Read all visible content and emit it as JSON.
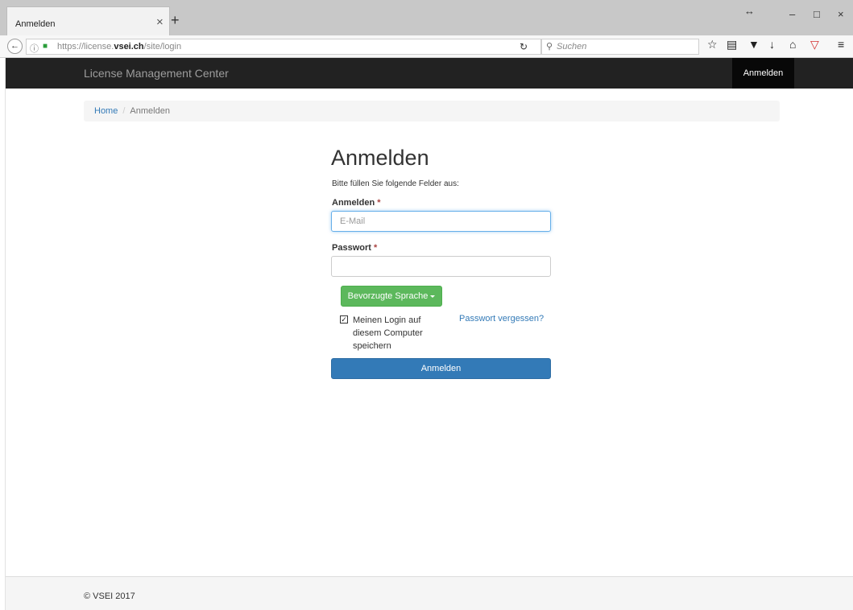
{
  "browser": {
    "tab_title": "Anmelden",
    "tab_close": "×",
    "new_tab": "+",
    "url_prefix": "https://license.",
    "url_domain": "vsei.ch",
    "url_path": "/site/login",
    "search_placeholder": "Suchen",
    "window": {
      "restore": "↔",
      "minimize": "–",
      "maximize": "□",
      "close": "×"
    }
  },
  "site": {
    "brand": "License Management Center",
    "nav_login": "Anmelden"
  },
  "breadcrumb": {
    "home": "Home",
    "separator": "/",
    "current": "Anmelden"
  },
  "form": {
    "title": "Anmelden",
    "hint": "Bitte füllen Sie folgende Felder aus:",
    "login_label": "Anmelden",
    "required_mark": "*",
    "login_placeholder": "E-Mail",
    "password_label": "Passwort",
    "language_button": "Bevorzugte Sprache",
    "remember_label": "Meinen Login auf diesem Computer speichern",
    "remember_checked": true,
    "forgot_link": "Passwort vergessen?",
    "submit_label": "Anmelden"
  },
  "footer": {
    "text": "© VSEI 2017"
  },
  "colors": {
    "nav_bg": "#222222",
    "primary": "#337ab7",
    "success": "#5cb85c",
    "required": "#a94442"
  }
}
